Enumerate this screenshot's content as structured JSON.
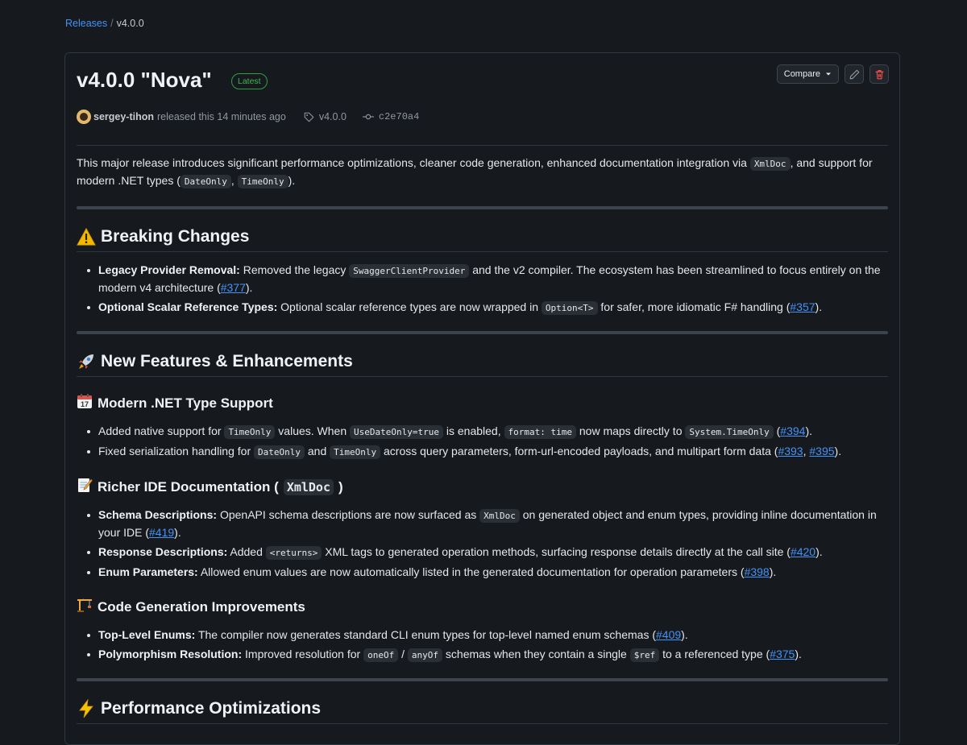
{
  "breadcrumb": {
    "releases": "Releases",
    "separator": "/",
    "current": "v4.0.0"
  },
  "release": {
    "title": "v4.0.0 \"Nova\"",
    "badge": "Latest",
    "compare_label": "Compare",
    "author": "sergey-tihon",
    "released_text": "released this 14 minutes ago",
    "tag": "v4.0.0",
    "commit": "c2e70a4"
  },
  "intro": {
    "t1": "This major release introduces significant performance optimizations, cleaner code generation, enhanced documentation integration via ",
    "c1": "XmlDoc",
    "t2": ", and support for modern .NET types (",
    "c2": "DateOnly",
    "t3": ", ",
    "c3": "TimeOnly",
    "t4": ")."
  },
  "breaking": {
    "icon": "warning-icon",
    "title": "Breaking Changes",
    "i1": {
      "b": "Legacy Provider Removal:",
      "t1": " Removed the legacy ",
      "c1": "SwaggerClientProvider",
      "t2": " and the v2 compiler. The ecosystem has been streamlined to focus entirely on the modern v4 architecture (",
      "l1": "#377",
      "t3": ")."
    },
    "i2": {
      "b": "Optional Scalar Reference Types:",
      "t1": " Optional scalar reference types are now wrapped in ",
      "c1": "Option<T>",
      "t2": " for safer, more idiomatic F# handling (",
      "l1": "#357",
      "t3": ")."
    }
  },
  "features": {
    "icon": "rocket-icon",
    "title": "New Features & Enhancements",
    "modern": {
      "icon": "calendar-icon",
      "title": "Modern .NET Type Support",
      "i1": {
        "t1": "Added native support for ",
        "c1": "TimeOnly",
        "t2": " values. When ",
        "c2": "UseDateOnly=true",
        "t3": " is enabled, ",
        "c3": "format: time",
        "t4": " now maps directly to ",
        "c4": "System.TimeOnly",
        "t5": " (",
        "l1": "#394",
        "t6": ")."
      },
      "i2": {
        "t1": "Fixed serialization handling for ",
        "c1": "DateOnly",
        "t2": " and ",
        "c2": "TimeOnly",
        "t3": " across query parameters, form-url-encoded payloads, and multipart form data (",
        "l1": "#393",
        "t4": ", ",
        "l2": "#395",
        "t5": ")."
      }
    },
    "richer": {
      "icon": "memo-icon",
      "title": "Richer IDE Documentation (",
      "code": "XmlDoc",
      "title_end": ")",
      "i1": {
        "b": "Schema Descriptions:",
        "t1": " OpenAPI schema descriptions are now surfaced as ",
        "c1": "XmlDoc",
        "t2": " on generated object and enum types, providing inline documentation in your IDE (",
        "l1": "#419",
        "t3": ")."
      },
      "i2": {
        "b": "Response Descriptions:",
        "t1": " Added ",
        "c1": "<returns>",
        "t2": " XML tags to generated operation methods, surfacing response details directly at the call site (",
        "l1": "#420",
        "t3": ")."
      },
      "i3": {
        "b": "Enum Parameters:",
        "t1": " Allowed enum values are now automatically listed in the generated documentation for operation parameters (",
        "l1": "#398",
        "t2": ")."
      }
    },
    "codegen": {
      "icon": "crane-icon",
      "title": "Code Generation Improvements",
      "i1": {
        "b": "Top-Level Enums:",
        "t1": " The compiler now generates standard CLI enum types for top-level named enum schemas (",
        "l1": "#409",
        "t2": ")."
      },
      "i2": {
        "b": "Polymorphism Resolution:",
        "t1": " Improved resolution for ",
        "c1": "oneOf",
        "t2": " / ",
        "c2": "anyOf",
        "t3": " schemas when they contain a single ",
        "c3": "$ref",
        "t4": " to a referenced type (",
        "l1": "#375",
        "t5": ")."
      }
    }
  },
  "performance": {
    "icon": "lightning-icon",
    "title": "Performance Optimizations"
  },
  "colors": {
    "background": "#16191d",
    "link": "#4493f8",
    "latest_badge": "#3fb950",
    "delete": "#f85149"
  }
}
